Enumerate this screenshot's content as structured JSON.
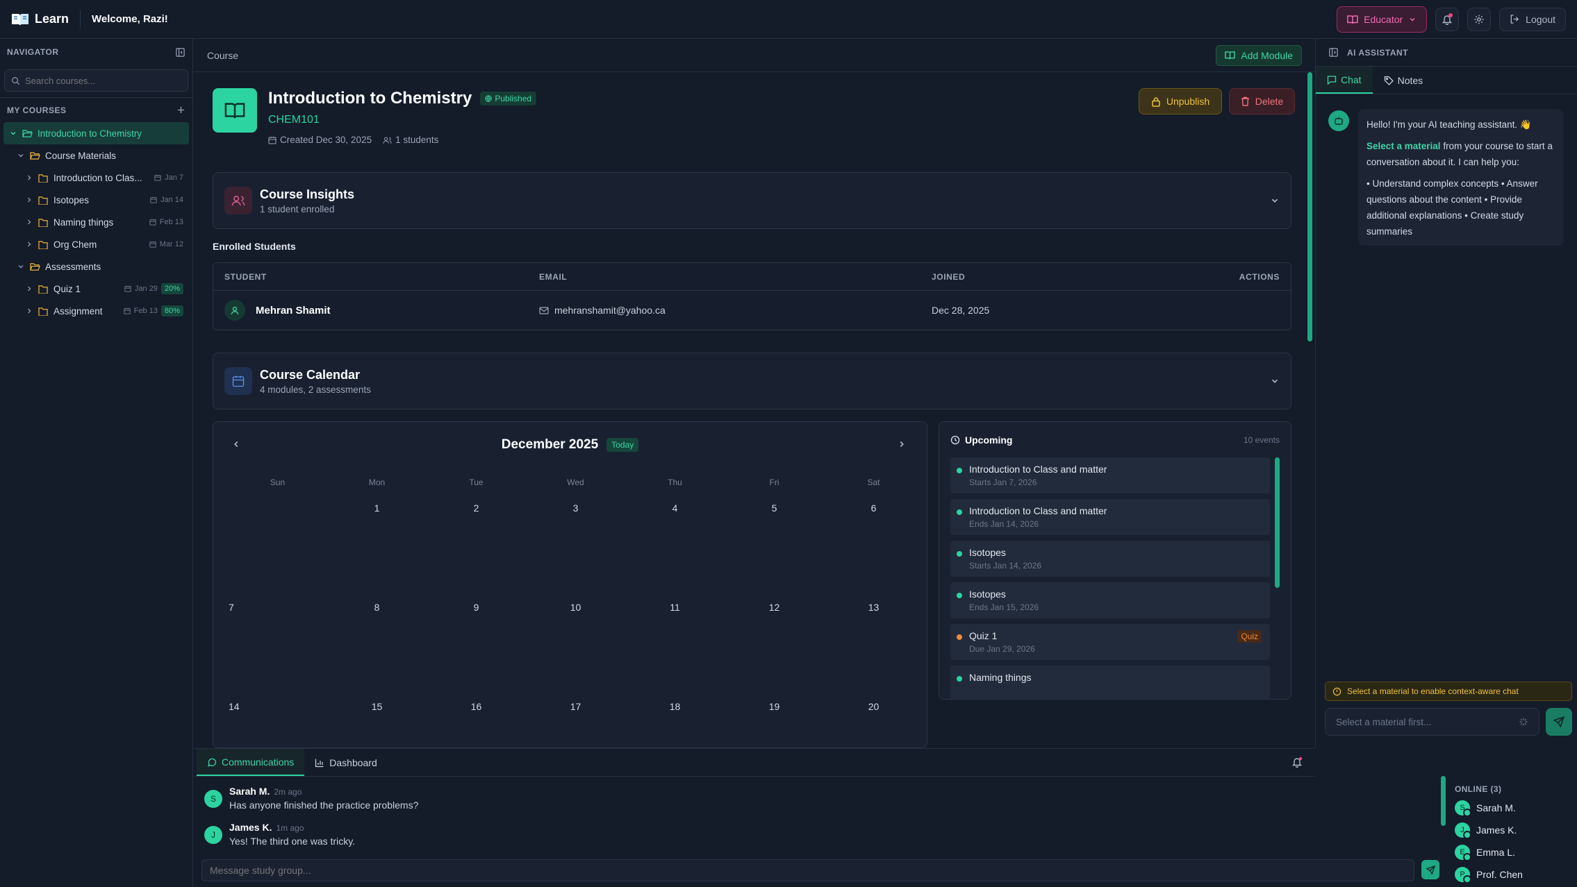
{
  "app": {
    "logo": "Learn",
    "welcome": "Welcome, Razi!"
  },
  "topbar": {
    "role_label": "Educator",
    "logout_label": "Logout"
  },
  "navigator": {
    "title": "NAVIGATOR",
    "search_placeholder": "Search courses...",
    "my_courses_label": "MY COURSES",
    "course": "Introduction to Chemistry",
    "materials_folder": "Course Materials",
    "materials": [
      {
        "name": "Introduction to Clas...",
        "date": "Jan 7"
      },
      {
        "name": "Isotopes",
        "date": "Jan 14"
      },
      {
        "name": "Naming things",
        "date": "Feb 13"
      },
      {
        "name": "Org Chem",
        "date": "Mar 12"
      }
    ],
    "assessments_folder": "Assessments",
    "assessments": [
      {
        "name": "Quiz 1",
        "date": "Jan 29",
        "weight": "20%"
      },
      {
        "name": "Assignment",
        "date": "Feb 13",
        "weight": "80%"
      }
    ]
  },
  "main": {
    "breadcrumb": "Course",
    "add_module_label": "Add Module",
    "course": {
      "title": "Introduction to Chemistry",
      "status": "Published",
      "code": "CHEM101",
      "created": "Created Dec 30, 2025",
      "students": "1 students",
      "unpublish_label": "Unpublish",
      "delete_label": "Delete"
    },
    "insights": {
      "title": "Course Insights",
      "subtitle": "1 student enrolled"
    },
    "enrolled": {
      "label": "Enrolled Students",
      "columns": [
        "STUDENT",
        "EMAIL",
        "JOINED",
        "ACTIONS"
      ],
      "rows": [
        {
          "name": "Mehran Shamit",
          "email": "mehranshamit@yahoo.ca",
          "joined": "Dec 28, 2025"
        }
      ]
    },
    "calendar_panel": {
      "title": "Course Calendar",
      "subtitle": "4 modules, 2 assessments"
    },
    "calendar": {
      "month": "December 2025",
      "today_label": "Today",
      "days_of_week": [
        "Sun",
        "Mon",
        "Tue",
        "Wed",
        "Thu",
        "Fri",
        "Sat"
      ],
      "weeks": [
        [
          "",
          "1",
          "2",
          "3",
          "4",
          "5",
          "6"
        ],
        [
          "7",
          "8",
          "9",
          "10",
          "11",
          "12",
          "13"
        ],
        [
          "14",
          "15",
          "16",
          "17",
          "18",
          "19",
          "20"
        ]
      ]
    },
    "upcoming": {
      "title": "Upcoming",
      "count": "10 events",
      "events": [
        {
          "title": "Introduction to Class and matter",
          "sub": "Starts Jan 7, 2026",
          "color": "#2bd4a0",
          "tag": ""
        },
        {
          "title": "Introduction to Class and matter",
          "sub": "Ends Jan 14, 2026",
          "color": "#2bd4a0",
          "tag": ""
        },
        {
          "title": "Isotopes",
          "sub": "Starts Jan 14, 2026",
          "color": "#2bd4a0",
          "tag": ""
        },
        {
          "title": "Isotopes",
          "sub": "Ends Jan 15, 2026",
          "color": "#2bd4a0",
          "tag": ""
        },
        {
          "title": "Quiz 1",
          "sub": "Due Jan 29, 2026",
          "color": "#f08a3a",
          "tag": "Quiz"
        },
        {
          "title": "Naming things",
          "sub": "",
          "color": "#2bd4a0",
          "tag": ""
        }
      ]
    }
  },
  "comms": {
    "tabs": [
      "Communications",
      "Dashboard"
    ],
    "messages": [
      {
        "initial": "S",
        "name": "Sarah M.",
        "time": "2m ago",
        "text": "Has anyone finished the practice problems?"
      },
      {
        "initial": "J",
        "name": "James K.",
        "time": "1m ago",
        "text": "Yes! The third one was tricky."
      }
    ],
    "input_placeholder": "Message study group...",
    "online_label": "ONLINE (3)",
    "online": [
      {
        "initial": "S",
        "name": "Sarah M."
      },
      {
        "initial": "J",
        "name": "James K."
      },
      {
        "initial": "E",
        "name": "Emma L."
      },
      {
        "initial": "P",
        "name": "Prof. Chen"
      }
    ]
  },
  "assistant": {
    "title": "AI ASSISTANT",
    "tabs": [
      "Chat",
      "Notes"
    ],
    "greeting": "Hello! I'm your AI teaching assistant. 👋",
    "select_link": "Select a material",
    "select_rest": " from your course to start a conversation about it. I can help you:",
    "capabilities": "• Understand complex concepts • Answer questions about the content • Provide additional explanations • Create study summaries",
    "warning": "Select a material to enable context-aware chat",
    "input_placeholder": "Select a material first..."
  },
  "colors": {
    "accent": "#2bd4a0",
    "educator": "#f06cb0",
    "warning": "#f0c23a",
    "danger": "#f07480",
    "quiz": "#f08a3a"
  }
}
